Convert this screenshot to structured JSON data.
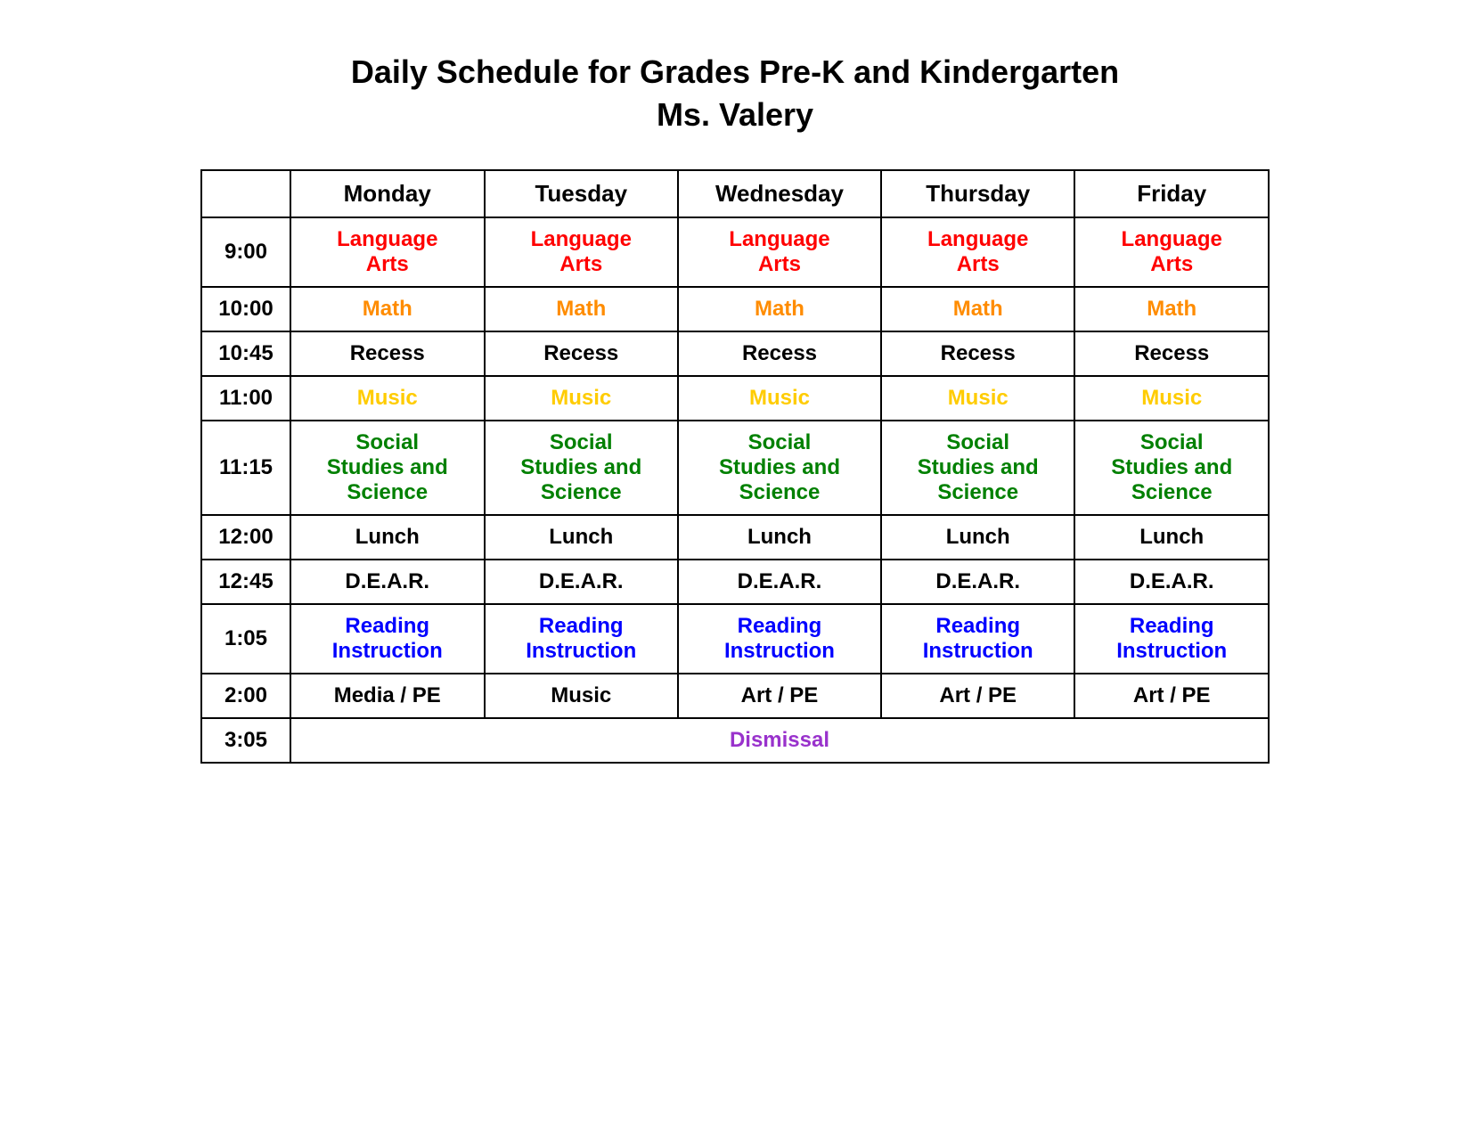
{
  "title": {
    "line1": "Daily Schedule for Grades Pre-K and Kindergarten",
    "line2": "Ms. Valery"
  },
  "headers": {
    "time": "",
    "monday": "Monday",
    "tuesday": "Tuesday",
    "wednesday": "Wednesday",
    "thursday": "Thursday",
    "friday": "Friday"
  },
  "rows": [
    {
      "time": "9:00",
      "subjects": [
        "Language Arts",
        "Language Arts",
        "Language Arts",
        "Language Arts",
        "Language Arts"
      ],
      "class": "language-arts"
    },
    {
      "time": "10:00",
      "subjects": [
        "Math",
        "Math",
        "Math",
        "Math",
        "Math"
      ],
      "class": "math"
    },
    {
      "time": "10:45",
      "subjects": [
        "Recess",
        "Recess",
        "Recess",
        "Recess",
        "Recess"
      ],
      "class": "recess"
    },
    {
      "time": "11:00",
      "subjects": [
        "Music",
        "Music",
        "Music",
        "Music",
        "Music"
      ],
      "class": "music"
    },
    {
      "time": "11:15",
      "subjects": [
        "Social Studies and Science",
        "Social Studies and Science",
        "Social Studies and Science",
        "Social Studies and Science",
        "Social Studies and Science"
      ],
      "class": "social-studies"
    },
    {
      "time": "12:00",
      "subjects": [
        "Lunch",
        "Lunch",
        "Lunch",
        "Lunch",
        "Lunch"
      ],
      "class": "lunch"
    },
    {
      "time": "12:45",
      "subjects": [
        "D.E.A.R.",
        "D.E.A.R.",
        "D.E.A.R.",
        "D.E.A.R.",
        "D.E.A.R."
      ],
      "class": "dear"
    },
    {
      "time": "1:05",
      "subjects": [
        "Reading Instruction",
        "Reading Instruction",
        "Reading Instruction",
        "Reading Instruction",
        "Reading Instruction"
      ],
      "class": "reading-instruction"
    },
    {
      "time": "2:00",
      "subjects": [
        "Media / PE",
        "Music",
        "Art / PE",
        "Art / PE",
        "Art / PE"
      ],
      "class": "media-pe"
    },
    {
      "time": "3:05",
      "dismissal": "Dismissal"
    }
  ]
}
